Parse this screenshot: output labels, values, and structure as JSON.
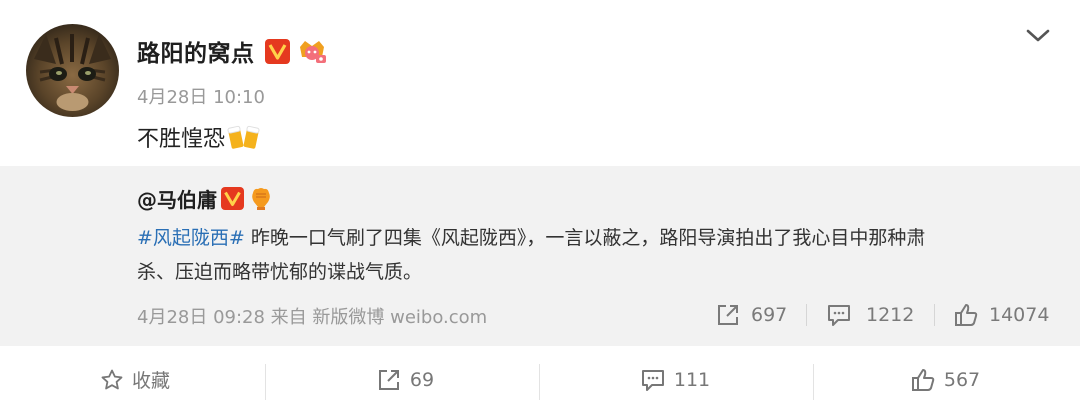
{
  "post": {
    "author": "路阳的窝点",
    "time": "4月28日 10:10",
    "text": "不胜惶恐"
  },
  "repost": {
    "author": "@马伯庸",
    "hashtag": "#风起陇西#",
    "text_line1": " 昨晚一口气刷了四集《风起陇西》，一言以蔽之，路阳导演拍出了我心目中那种肃",
    "text_line2": "杀、压迫而略带忧郁的谍战气质。",
    "meta": "4月28日 09:28 来自 新版微博 weibo.com",
    "stats": {
      "reposts": "697",
      "comments": "1212",
      "likes": "14074"
    }
  },
  "actions": {
    "favorite": "收藏",
    "repost": "69",
    "comment": "111",
    "like": "567"
  },
  "colors": {
    "hashtag": "#2a6fb5",
    "verified_badge": "#e5391f",
    "repost_bg": "#f2f2f2"
  },
  "icons": [
    "cat-avatar",
    "verified-v-icon",
    "crown-icon",
    "chevron-down-icon",
    "beer-icon",
    "fist-icon",
    "repost-icon",
    "comment-icon",
    "like-icon",
    "star-icon"
  ]
}
